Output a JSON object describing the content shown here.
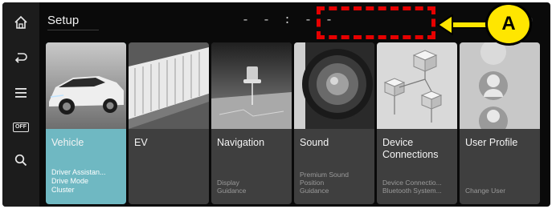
{
  "header": {
    "title": "Setup",
    "clock": "- - : - -"
  },
  "rail": {
    "items": [
      {
        "icon": "home-icon"
      },
      {
        "icon": "back-icon"
      },
      {
        "icon": "menu-icon"
      },
      {
        "icon": "screen-off-icon",
        "badge": "OFF"
      },
      {
        "icon": "search-icon"
      }
    ]
  },
  "cards": [
    {
      "label": "Vehicle",
      "subs": [
        "Driver Assistan...",
        "Drive Mode",
        "Cluster"
      ],
      "active": true
    },
    {
      "label": "EV",
      "subs": []
    },
    {
      "label": "Navigation",
      "subs": [
        "Display",
        "Guidance"
      ]
    },
    {
      "label": "Sound",
      "subs": [
        "Premium Sound",
        "Position",
        "Guidance"
      ]
    },
    {
      "label": "Device Connections",
      "subs": [
        "Device Connectio...",
        "Bluetooth System..."
      ]
    },
    {
      "label": "User Profile",
      "subs": [
        "Change User"
      ]
    }
  ],
  "annotation": {
    "letter": "A",
    "box_color": "#e60000",
    "circle_color": "#ffe600"
  },
  "colors": {
    "active_card": "#6fb8c2",
    "card": "#3f3f3f",
    "background": "#0a0a0a"
  }
}
